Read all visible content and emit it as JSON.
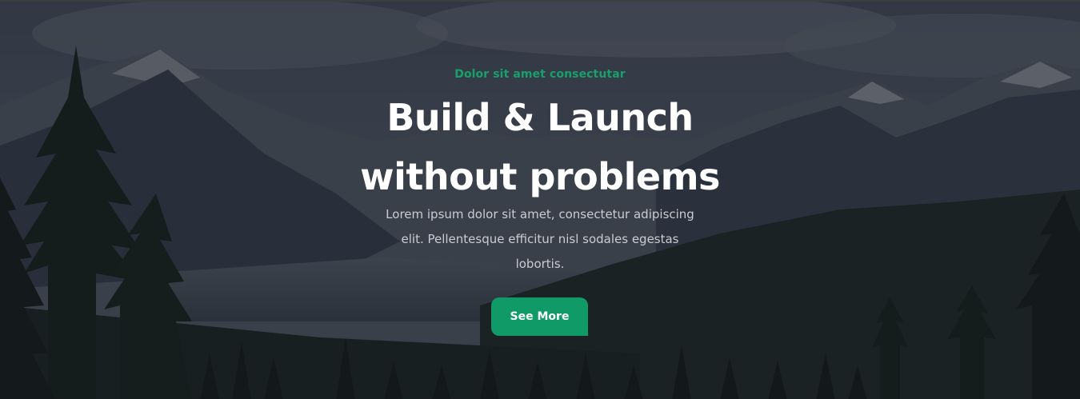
{
  "hero": {
    "eyebrow": "Dolor sit amet consectutar",
    "title_line1": "Build & Launch",
    "title_line2": "without problems",
    "description": "Lorem ipsum dolor sit amet, consectetur adipiscing elit. Pellentesque efficitur nisl sodales egestas lobortis.",
    "button_label": "See More"
  },
  "colors": {
    "accent": "#0f9a68",
    "eyebrow": "#18a06a",
    "title": "#ffffff",
    "description": "#c9ccd2"
  }
}
